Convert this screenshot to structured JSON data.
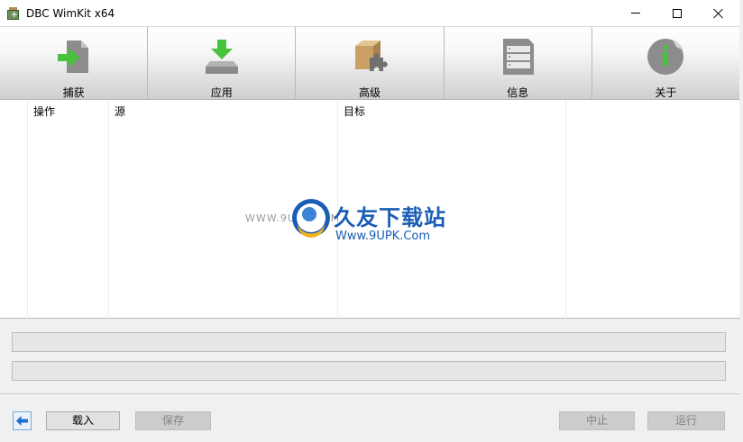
{
  "window": {
    "title": "DBC WimKit x64"
  },
  "toolbar": {
    "items": [
      {
        "label": "捕获",
        "icon": "capture-arrow-icon"
      },
      {
        "label": "应用",
        "icon": "apply-download-icon"
      },
      {
        "label": "高级",
        "icon": "advanced-puzzle-box-icon"
      },
      {
        "label": "信息",
        "icon": "info-document-icon"
      },
      {
        "label": "关于",
        "icon": "about-info-icon"
      }
    ]
  },
  "list": {
    "columns": [
      "操作",
      "源",
      "目标"
    ]
  },
  "watermark": {
    "left_text": "WWW.9UPK.COM",
    "cn_text": "久友下载站",
    "url_text": "Www.9UPK.Com"
  },
  "progress": {
    "bar1": 0,
    "bar2": 0
  },
  "buttons": {
    "load": "载入",
    "save": "保存",
    "abort": "中止",
    "run": "运行"
  },
  "colors": {
    "accent_blue": "#1a5db4",
    "arrow_green": "#41c23b",
    "progress_green": "#06b025"
  }
}
